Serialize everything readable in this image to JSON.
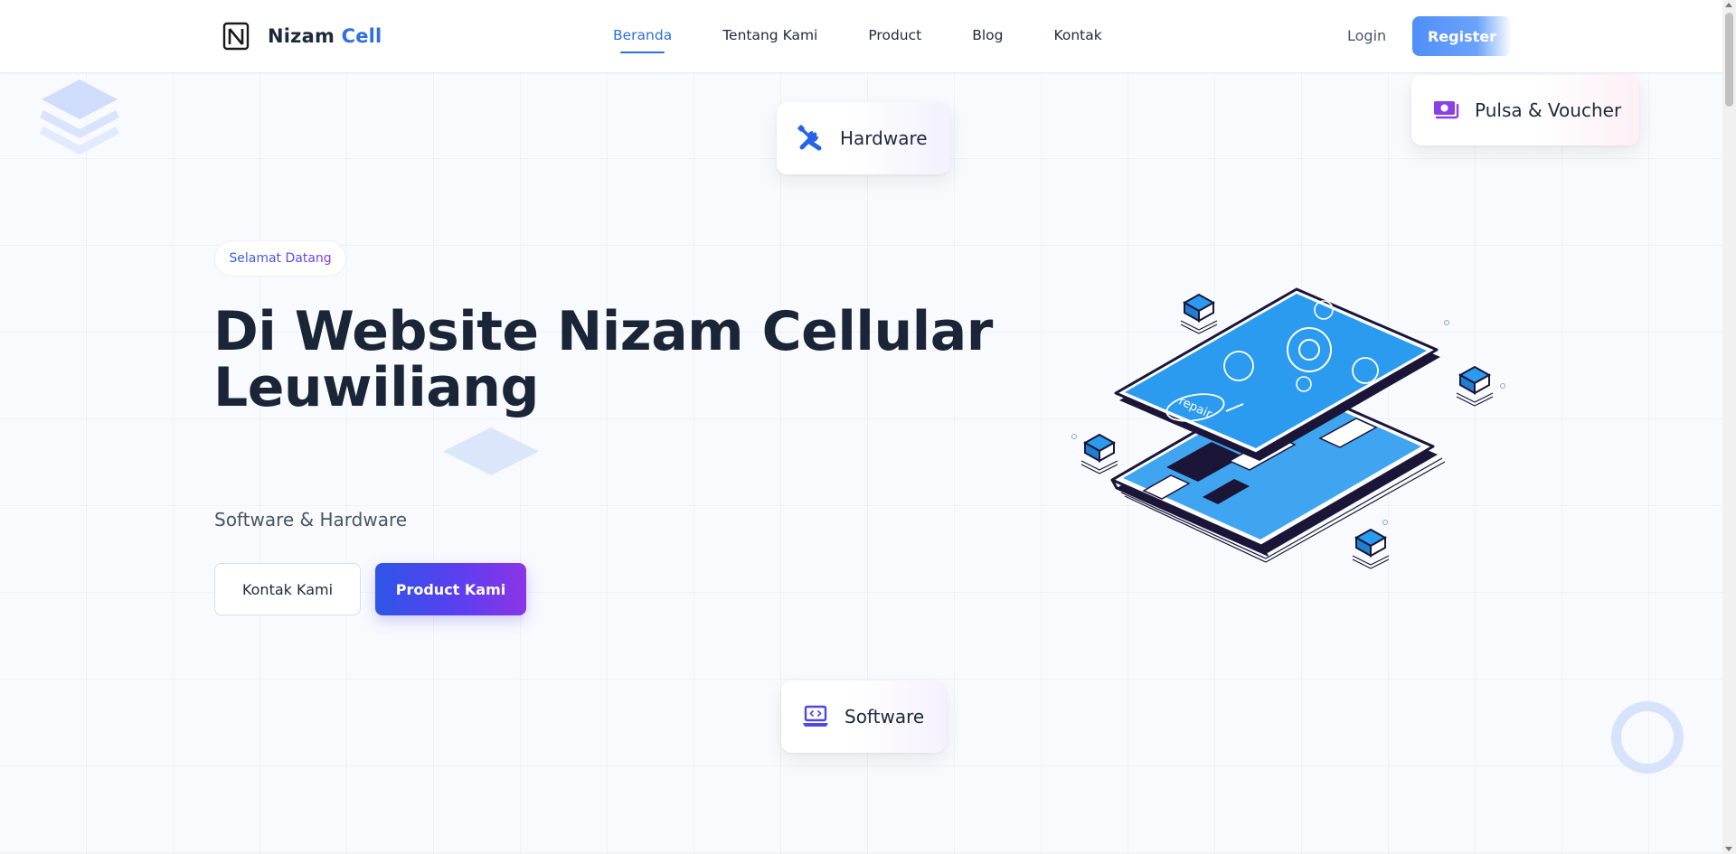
{
  "header": {
    "brand": {
      "name_part1": "Nizam",
      "name_part2": "Cell",
      "logo_icon": "n-logo-icon"
    },
    "nav": [
      {
        "label": "Beranda",
        "active": true
      },
      {
        "label": "Tentang Kami",
        "active": false
      },
      {
        "label": "Product",
        "active": false
      },
      {
        "label": "Blog",
        "active": false
      },
      {
        "label": "Kontak",
        "active": false
      }
    ],
    "login_label": "Login",
    "register_label": "Register"
  },
  "cards": {
    "hardware": {
      "label": "Hardware",
      "icon": "tools-icon"
    },
    "pulsa": {
      "label": "Pulsa & Voucher",
      "icon": "money-icon"
    },
    "software": {
      "label": "Software",
      "icon": "laptop-code-icon"
    }
  },
  "hero": {
    "badge": "Selamat Datang",
    "title_line1": "Di Website Nizam Cellular",
    "title_line2": "Leuwiliang",
    "subtitle": "Software & Hardware",
    "button_contact": "Kontak Kami",
    "button_product": "Product Kami",
    "illustration_label": "repair"
  },
  "colors": {
    "accent": "#2f6fe0",
    "primary_gradient_start": "#2d56e6",
    "primary_gradient_end": "#8b35e6",
    "illustration_blue": "#2b9bf0",
    "illustration_dark": "#1b1638"
  }
}
